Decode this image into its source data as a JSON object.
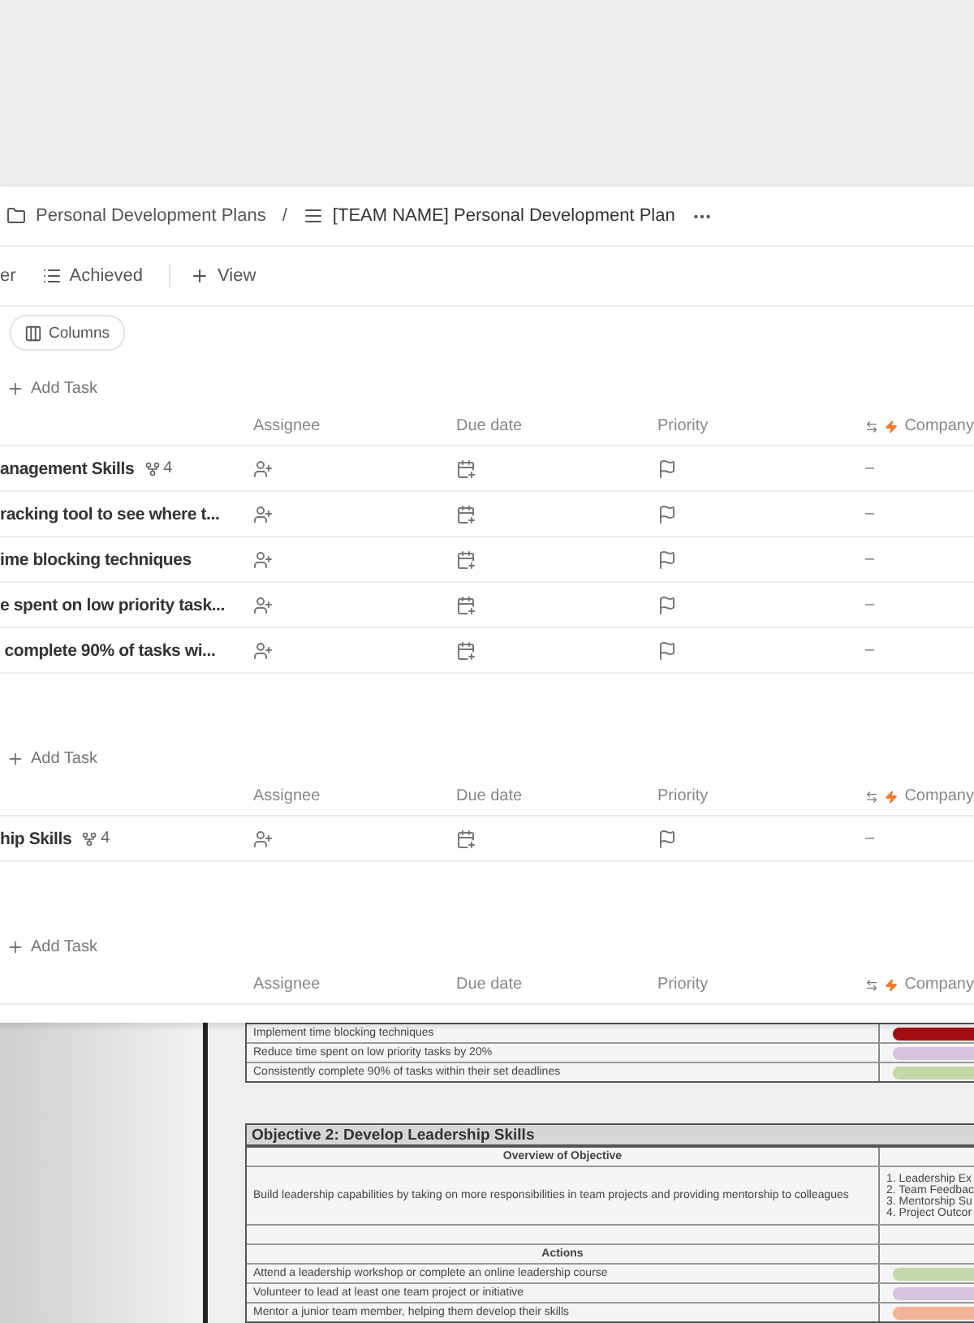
{
  "breadcrumb": {
    "folder": "Personal Development Plans",
    "separator": "/",
    "page": "[TEAM NAME] Personal Development Plan"
  },
  "views": [
    {
      "label": "er",
      "kind": "text"
    },
    {
      "label": "Achieved",
      "kind": "list"
    }
  ],
  "add_view": "View",
  "columns_button": "Columns",
  "groups": [
    {
      "add_task": "Add Task",
      "columns": [
        "Assignee",
        "Due date",
        "Priority",
        "Company"
      ],
      "rows": [
        {
          "name": "anagement Skills",
          "subtasks": "4",
          "company": "–"
        },
        {
          "name": "racking tool to see where t...",
          "company": "–"
        },
        {
          "name": "ime blocking techniques",
          "company": "–"
        },
        {
          "name": "e spent on low priority task...",
          "company": "–"
        },
        {
          "name": " complete 90% of tasks wi...",
          "company": "–"
        }
      ]
    },
    {
      "add_task": "Add Task",
      "columns": [
        "Assignee",
        "Due date",
        "Priority",
        "Company"
      ],
      "rows": [
        {
          "name": "hip Skills",
          "subtasks": "4",
          "company": "–"
        }
      ]
    },
    {
      "add_task": "Add Task",
      "columns": [
        "Assignee",
        "Due date",
        "Priority",
        "Company"
      ]
    }
  ],
  "sheet": {
    "top_rows": [
      {
        "text": "Implement time blocking techniques",
        "color": "#a30f12"
      },
      {
        "text": "Reduce time spent on low priority tasks by 20%",
        "color": "#d5c3df"
      },
      {
        "text": "Consistently complete 90% of tasks within their set deadlines",
        "color": "#c4d9aa"
      }
    ],
    "objective": "Objective 2: Develop Leadership Skills",
    "overview_header": "Overview of Objective",
    "overview": "Build leadership capabilities by taking on more responsibilities in team projects and providing mentorship to colleagues",
    "measures": [
      "1. Leadership Ex",
      "2. Team Feedbac",
      "3. Mentorship Su",
      "4. Project Outcor"
    ],
    "actions_header": "Actions",
    "actions": [
      {
        "text": "Attend a leadership workshop or complete an online leadership course",
        "color": "#c4d9aa"
      },
      {
        "text": "Volunteer to lead at least one team project or initiative",
        "color": "#d5c3df"
      },
      {
        "text": "Mentor a junior team member, helping them develop their skills",
        "color": "#f3b597"
      }
    ]
  }
}
